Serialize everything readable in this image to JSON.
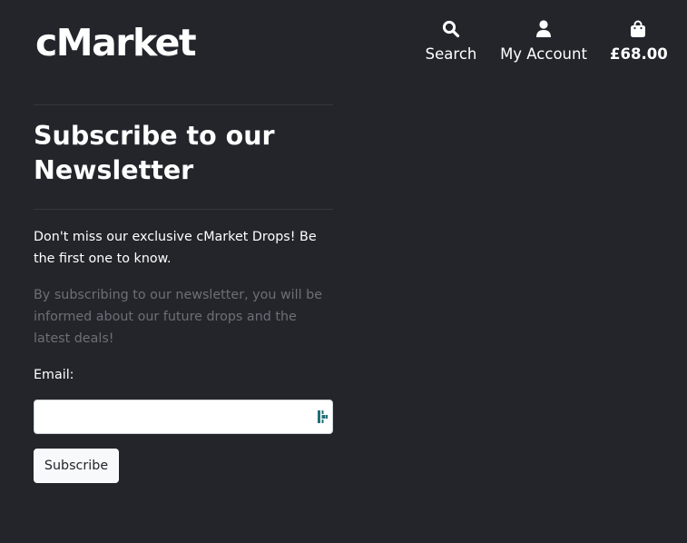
{
  "header": {
    "logo": "cMarket",
    "nav": {
      "search": {
        "label": "Search",
        "icon": "search-icon"
      },
      "account": {
        "label": "My Account",
        "icon": "user-icon"
      },
      "cart": {
        "label": "£68.00",
        "icon": "shopping-bag-icon"
      }
    }
  },
  "newsletter": {
    "title": "Subscribe to our Newsletter",
    "lead": "Don't miss our exclusive cMarket Drops! Be the first one to know.",
    "description": "By subscribing to our newsletter, you will be informed about our future drops and the latest deals!",
    "email_label": "Email:",
    "email_value": "",
    "email_icon": "password-manager-icon",
    "subscribe_label": "Subscribe"
  },
  "colors": {
    "background": "#23252b",
    "text": "#ffffff",
    "muted_text": "#6c6f75",
    "button_bg": "#f8f9fa",
    "input_icon": "#1f6f78"
  }
}
